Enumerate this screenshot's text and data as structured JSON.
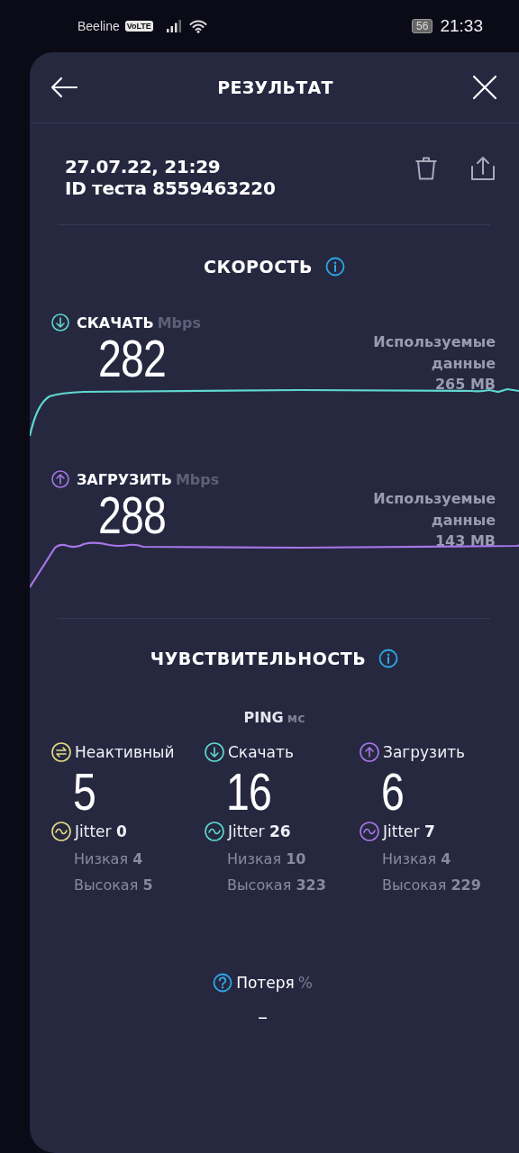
{
  "status_bar": {
    "carrier": "Beeline",
    "volte": "VoLTE",
    "battery": "56",
    "time": "21:33"
  },
  "header": {
    "title": "РЕЗУЛЬТАТ"
  },
  "test": {
    "datetime": "27.07.22, 21:29",
    "id_line": "ID теста 8559463220"
  },
  "speed": {
    "title": "СКОРОСТЬ",
    "measurements": [
      {
        "kind": "download",
        "label": "СКАЧАТЬ",
        "unit": "Mbps",
        "value": "282",
        "data_label": "Используемые данные",
        "data_amount": "265 MB"
      },
      {
        "kind": "upload",
        "label": "ЗАГРУЗИТЬ",
        "unit": "Mbps",
        "value": "288",
        "data_label": "Используемые данные",
        "data_amount": "143 MB"
      }
    ]
  },
  "latency": {
    "title": "ЧУВСТВИТЕЛЬНОСТЬ",
    "ping_label": "PING",
    "ping_unit": "мс",
    "columns": [
      {
        "kind": "idle",
        "label": "Неактивный",
        "value": "5",
        "jitter_label": "Jitter",
        "jitter": "0",
        "low_label": "Низкая",
        "low": "4",
        "high_label": "Высокая",
        "high": "5"
      },
      {
        "kind": "download",
        "label": "Скачать",
        "value": "16",
        "jitter_label": "Jitter",
        "jitter": "26",
        "low_label": "Низкая",
        "low": "10",
        "high_label": "Высокая",
        "high": "323"
      },
      {
        "kind": "upload",
        "label": "Загрузить",
        "value": "6",
        "jitter_label": "Jitter",
        "jitter": "7",
        "low_label": "Низкая",
        "low": "4",
        "high_label": "Высокая",
        "high": "229"
      }
    ]
  },
  "loss": {
    "label": "Потеря",
    "unit": "%",
    "value": "–"
  }
}
